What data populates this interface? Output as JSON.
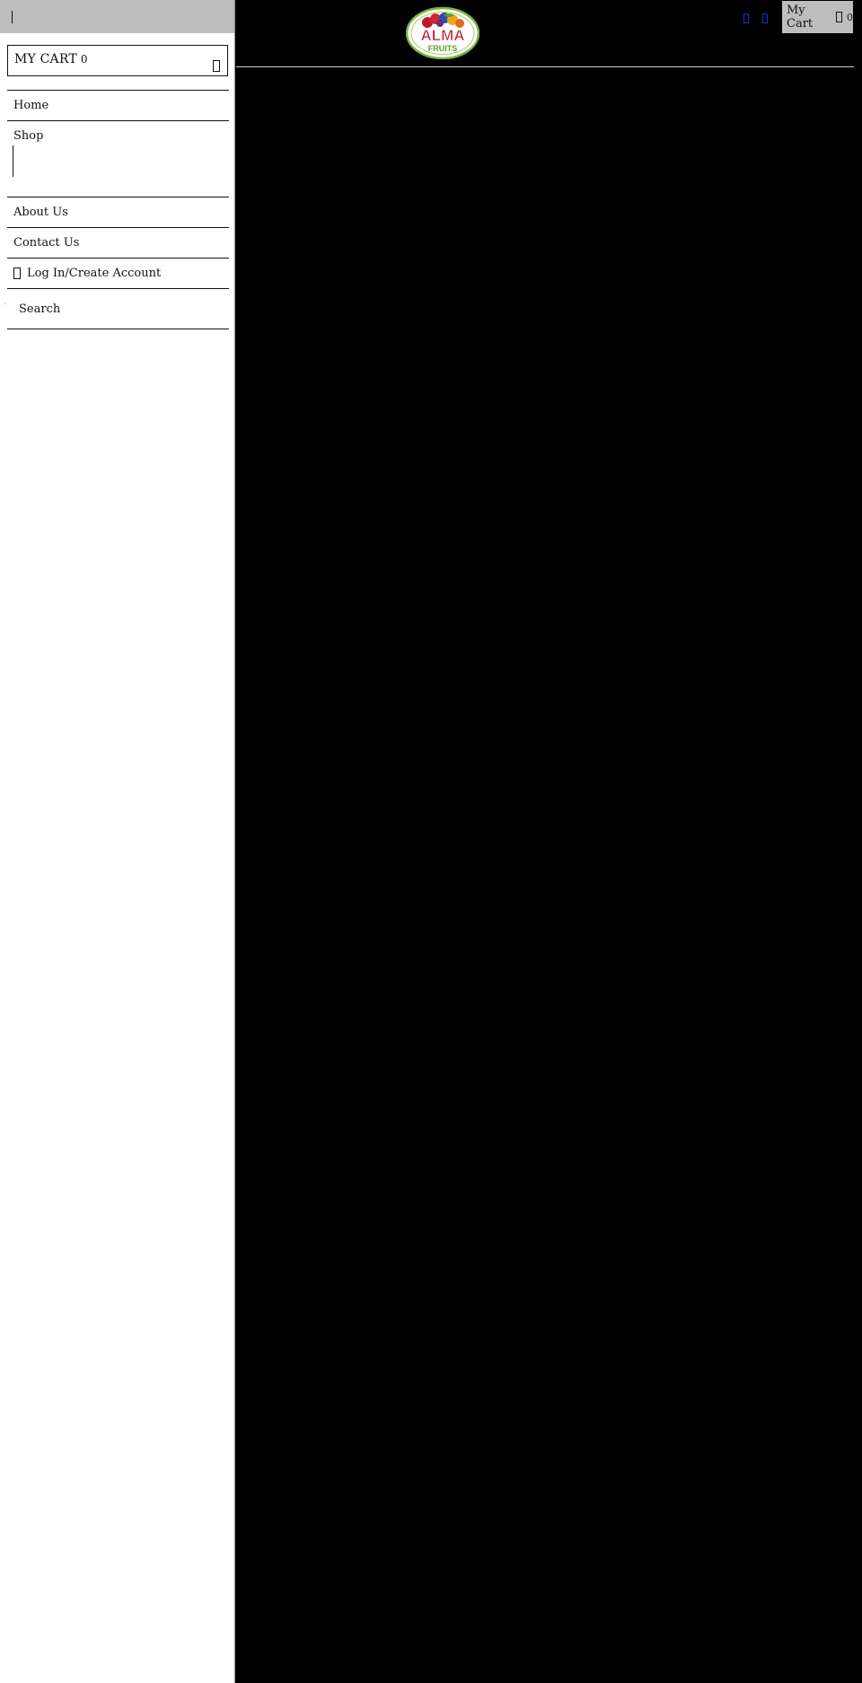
{
  "sidebar": {
    "cart_label": "MY CART",
    "cart_count": "0",
    "nav": {
      "home": "Home",
      "shop": "Shop",
      "about": "About Us",
      "contact": "Contact Us",
      "login": "Log In/Create Account",
      "search": "Search"
    }
  },
  "header": {
    "logo": {
      "top_text": "ALMA",
      "bottom_text": "FRUITS"
    },
    "cart_label": "My Cart",
    "cart_count": "0"
  },
  "colors": {
    "main_background": "#000000",
    "sidebar_background": "#ffffff",
    "sidebar_topbar": "#bdbdbd",
    "icon_blue": "#1a2bd6",
    "logo_green": "#7ab43a"
  },
  "icons": {
    "sidebar_close": "close-icon",
    "cart": "cart-icon",
    "login": "user-icon",
    "header_icon_1": "search-icon",
    "header_icon_2": "user-icon"
  }
}
